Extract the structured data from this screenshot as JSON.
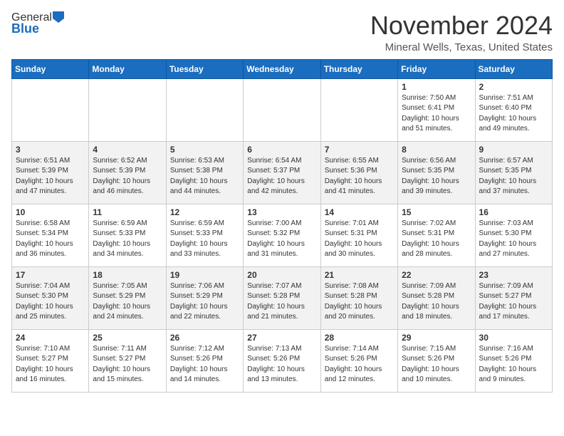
{
  "logo": {
    "general": "General",
    "blue": "Blue"
  },
  "header": {
    "month_title": "November 2024",
    "location": "Mineral Wells, Texas, United States"
  },
  "weekdays": [
    "Sunday",
    "Monday",
    "Tuesday",
    "Wednesday",
    "Thursday",
    "Friday",
    "Saturday"
  ],
  "weeks": [
    [
      {
        "day": "",
        "info": ""
      },
      {
        "day": "",
        "info": ""
      },
      {
        "day": "",
        "info": ""
      },
      {
        "day": "",
        "info": ""
      },
      {
        "day": "",
        "info": ""
      },
      {
        "day": "1",
        "info": "Sunrise: 7:50 AM\nSunset: 6:41 PM\nDaylight: 10 hours and 51 minutes."
      },
      {
        "day": "2",
        "info": "Sunrise: 7:51 AM\nSunset: 6:40 PM\nDaylight: 10 hours and 49 minutes."
      }
    ],
    [
      {
        "day": "3",
        "info": "Sunrise: 6:51 AM\nSunset: 5:39 PM\nDaylight: 10 hours and 47 minutes."
      },
      {
        "day": "4",
        "info": "Sunrise: 6:52 AM\nSunset: 5:39 PM\nDaylight: 10 hours and 46 minutes."
      },
      {
        "day": "5",
        "info": "Sunrise: 6:53 AM\nSunset: 5:38 PM\nDaylight: 10 hours and 44 minutes."
      },
      {
        "day": "6",
        "info": "Sunrise: 6:54 AM\nSunset: 5:37 PM\nDaylight: 10 hours and 42 minutes."
      },
      {
        "day": "7",
        "info": "Sunrise: 6:55 AM\nSunset: 5:36 PM\nDaylight: 10 hours and 41 minutes."
      },
      {
        "day": "8",
        "info": "Sunrise: 6:56 AM\nSunset: 5:35 PM\nDaylight: 10 hours and 39 minutes."
      },
      {
        "day": "9",
        "info": "Sunrise: 6:57 AM\nSunset: 5:35 PM\nDaylight: 10 hours and 37 minutes."
      }
    ],
    [
      {
        "day": "10",
        "info": "Sunrise: 6:58 AM\nSunset: 5:34 PM\nDaylight: 10 hours and 36 minutes."
      },
      {
        "day": "11",
        "info": "Sunrise: 6:59 AM\nSunset: 5:33 PM\nDaylight: 10 hours and 34 minutes."
      },
      {
        "day": "12",
        "info": "Sunrise: 6:59 AM\nSunset: 5:33 PM\nDaylight: 10 hours and 33 minutes."
      },
      {
        "day": "13",
        "info": "Sunrise: 7:00 AM\nSunset: 5:32 PM\nDaylight: 10 hours and 31 minutes."
      },
      {
        "day": "14",
        "info": "Sunrise: 7:01 AM\nSunset: 5:31 PM\nDaylight: 10 hours and 30 minutes."
      },
      {
        "day": "15",
        "info": "Sunrise: 7:02 AM\nSunset: 5:31 PM\nDaylight: 10 hours and 28 minutes."
      },
      {
        "day": "16",
        "info": "Sunrise: 7:03 AM\nSunset: 5:30 PM\nDaylight: 10 hours and 27 minutes."
      }
    ],
    [
      {
        "day": "17",
        "info": "Sunrise: 7:04 AM\nSunset: 5:30 PM\nDaylight: 10 hours and 25 minutes."
      },
      {
        "day": "18",
        "info": "Sunrise: 7:05 AM\nSunset: 5:29 PM\nDaylight: 10 hours and 24 minutes."
      },
      {
        "day": "19",
        "info": "Sunrise: 7:06 AM\nSunset: 5:29 PM\nDaylight: 10 hours and 22 minutes."
      },
      {
        "day": "20",
        "info": "Sunrise: 7:07 AM\nSunset: 5:28 PM\nDaylight: 10 hours and 21 minutes."
      },
      {
        "day": "21",
        "info": "Sunrise: 7:08 AM\nSunset: 5:28 PM\nDaylight: 10 hours and 20 minutes."
      },
      {
        "day": "22",
        "info": "Sunrise: 7:09 AM\nSunset: 5:28 PM\nDaylight: 10 hours and 18 minutes."
      },
      {
        "day": "23",
        "info": "Sunrise: 7:09 AM\nSunset: 5:27 PM\nDaylight: 10 hours and 17 minutes."
      }
    ],
    [
      {
        "day": "24",
        "info": "Sunrise: 7:10 AM\nSunset: 5:27 PM\nDaylight: 10 hours and 16 minutes."
      },
      {
        "day": "25",
        "info": "Sunrise: 7:11 AM\nSunset: 5:27 PM\nDaylight: 10 hours and 15 minutes."
      },
      {
        "day": "26",
        "info": "Sunrise: 7:12 AM\nSunset: 5:26 PM\nDaylight: 10 hours and 14 minutes."
      },
      {
        "day": "27",
        "info": "Sunrise: 7:13 AM\nSunset: 5:26 PM\nDaylight: 10 hours and 13 minutes."
      },
      {
        "day": "28",
        "info": "Sunrise: 7:14 AM\nSunset: 5:26 PM\nDaylight: 10 hours and 12 minutes."
      },
      {
        "day": "29",
        "info": "Sunrise: 7:15 AM\nSunset: 5:26 PM\nDaylight: 10 hours and 10 minutes."
      },
      {
        "day": "30",
        "info": "Sunrise: 7:16 AM\nSunset: 5:26 PM\nDaylight: 10 hours and 9 minutes."
      }
    ]
  ]
}
